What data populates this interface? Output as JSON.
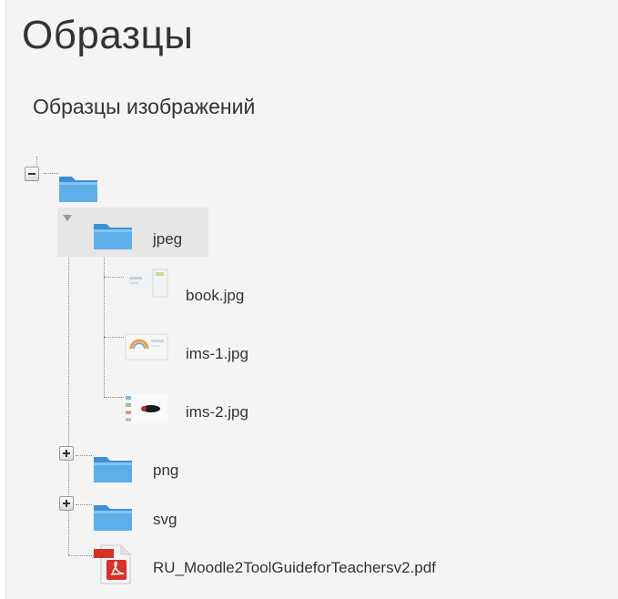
{
  "page": {
    "title": "Образцы"
  },
  "section": {
    "title": "Образцы изображений"
  },
  "tree": {
    "root": {
      "icon": "folder-icon",
      "expanded": true
    },
    "folders": [
      {
        "label": "jpeg",
        "expanded": true,
        "files": [
          {
            "label": "book.jpg",
            "icon": "image-thumbnail"
          },
          {
            "label": "ims-1.jpg",
            "icon": "image-thumbnail"
          },
          {
            "label": "ims-2.jpg",
            "icon": "image-thumbnail"
          }
        ]
      },
      {
        "label": "png",
        "expanded": false
      },
      {
        "label": "svg",
        "expanded": false
      }
    ],
    "files": [
      {
        "label": "RU_Moodle2ToolGuideforTeachersv2.pdf",
        "icon": "pdf-icon"
      }
    ]
  },
  "colors": {
    "folder": "#5aa7e6",
    "folder_dark": "#2f7fc8",
    "pdf_red": "#d7312a",
    "panel_bg": "#f4f4f4"
  }
}
